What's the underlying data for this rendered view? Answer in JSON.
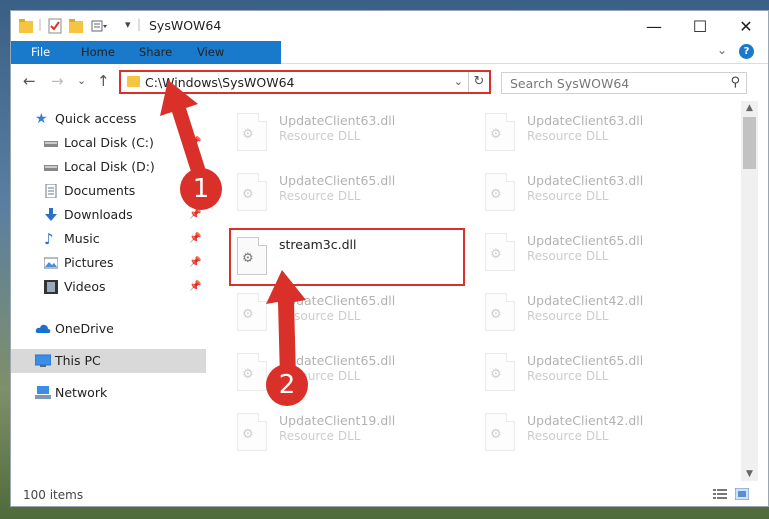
{
  "window": {
    "title": "SysWOW64",
    "controls": {
      "minimize": "—",
      "maximize": "☐",
      "close": "✕"
    }
  },
  "ribbon": {
    "tabs": [
      "File",
      "Home",
      "Share",
      "View"
    ],
    "expand": "⌄",
    "help": "?"
  },
  "address": {
    "path": "C:\\Windows\\SysWOW64",
    "dropdown": "⌄",
    "refresh": "↻"
  },
  "search": {
    "placeholder": "Search SysWOW64"
  },
  "nav": {
    "back": "←",
    "forward": "→",
    "recent": "⌄",
    "up": "↑",
    "items": [
      {
        "label": "Quick access",
        "icon": "star-icon",
        "pinned": false
      },
      {
        "label": "Local Disk (C:)",
        "icon": "drive-icon",
        "pinned": true
      },
      {
        "label": "Local Disk (D:)",
        "icon": "drive-icon",
        "pinned": false
      },
      {
        "label": "Documents",
        "icon": "document-icon",
        "pinned": true
      },
      {
        "label": "Downloads",
        "icon": "download-icon",
        "pinned": true
      },
      {
        "label": "Music",
        "icon": "music-icon",
        "pinned": true
      },
      {
        "label": "Pictures",
        "icon": "picture-icon",
        "pinned": true
      },
      {
        "label": "Videos",
        "icon": "video-icon",
        "pinned": true
      },
      {
        "label": "OneDrive",
        "icon": "cloud-icon",
        "pinned": false
      },
      {
        "label": "This PC",
        "icon": "computer-icon",
        "pinned": false
      },
      {
        "label": "Network",
        "icon": "network-icon",
        "pinned": false
      }
    ]
  },
  "files": {
    "col1": [
      {
        "name": "UpdateClient63.dll",
        "type": "Resource DLL"
      },
      {
        "name": "UpdateClient65.dll",
        "type": "Resource DLL"
      },
      {
        "name": "stream3c.dll",
        "type": ""
      },
      {
        "name": "UpdateClient65.dll",
        "type": "Resource DLL"
      },
      {
        "name": "UpdateClient65.dll",
        "type": "Resource DLL"
      },
      {
        "name": "UpdateClient19.dll",
        "type": "Resource DLL"
      }
    ],
    "col2": [
      {
        "name": "UpdateClient63.dll",
        "type": "Resource DLL"
      },
      {
        "name": "UpdateClient63.dll",
        "type": "Resource DLL"
      },
      {
        "name": "UpdateClient65.dll",
        "type": "Resource DLL"
      },
      {
        "name": "UpdateClient42.dll",
        "type": "Resource DLL"
      },
      {
        "name": "UpdateClient65.dll",
        "type": "Resource DLL"
      },
      {
        "name": "UpdateClient42.dll",
        "type": "Resource DLL"
      }
    ]
  },
  "status": {
    "count": "100 items"
  },
  "callouts": {
    "step1": "1",
    "step2": "2"
  },
  "colors": {
    "accent": "#1979ca",
    "callout": "#d9312a"
  }
}
